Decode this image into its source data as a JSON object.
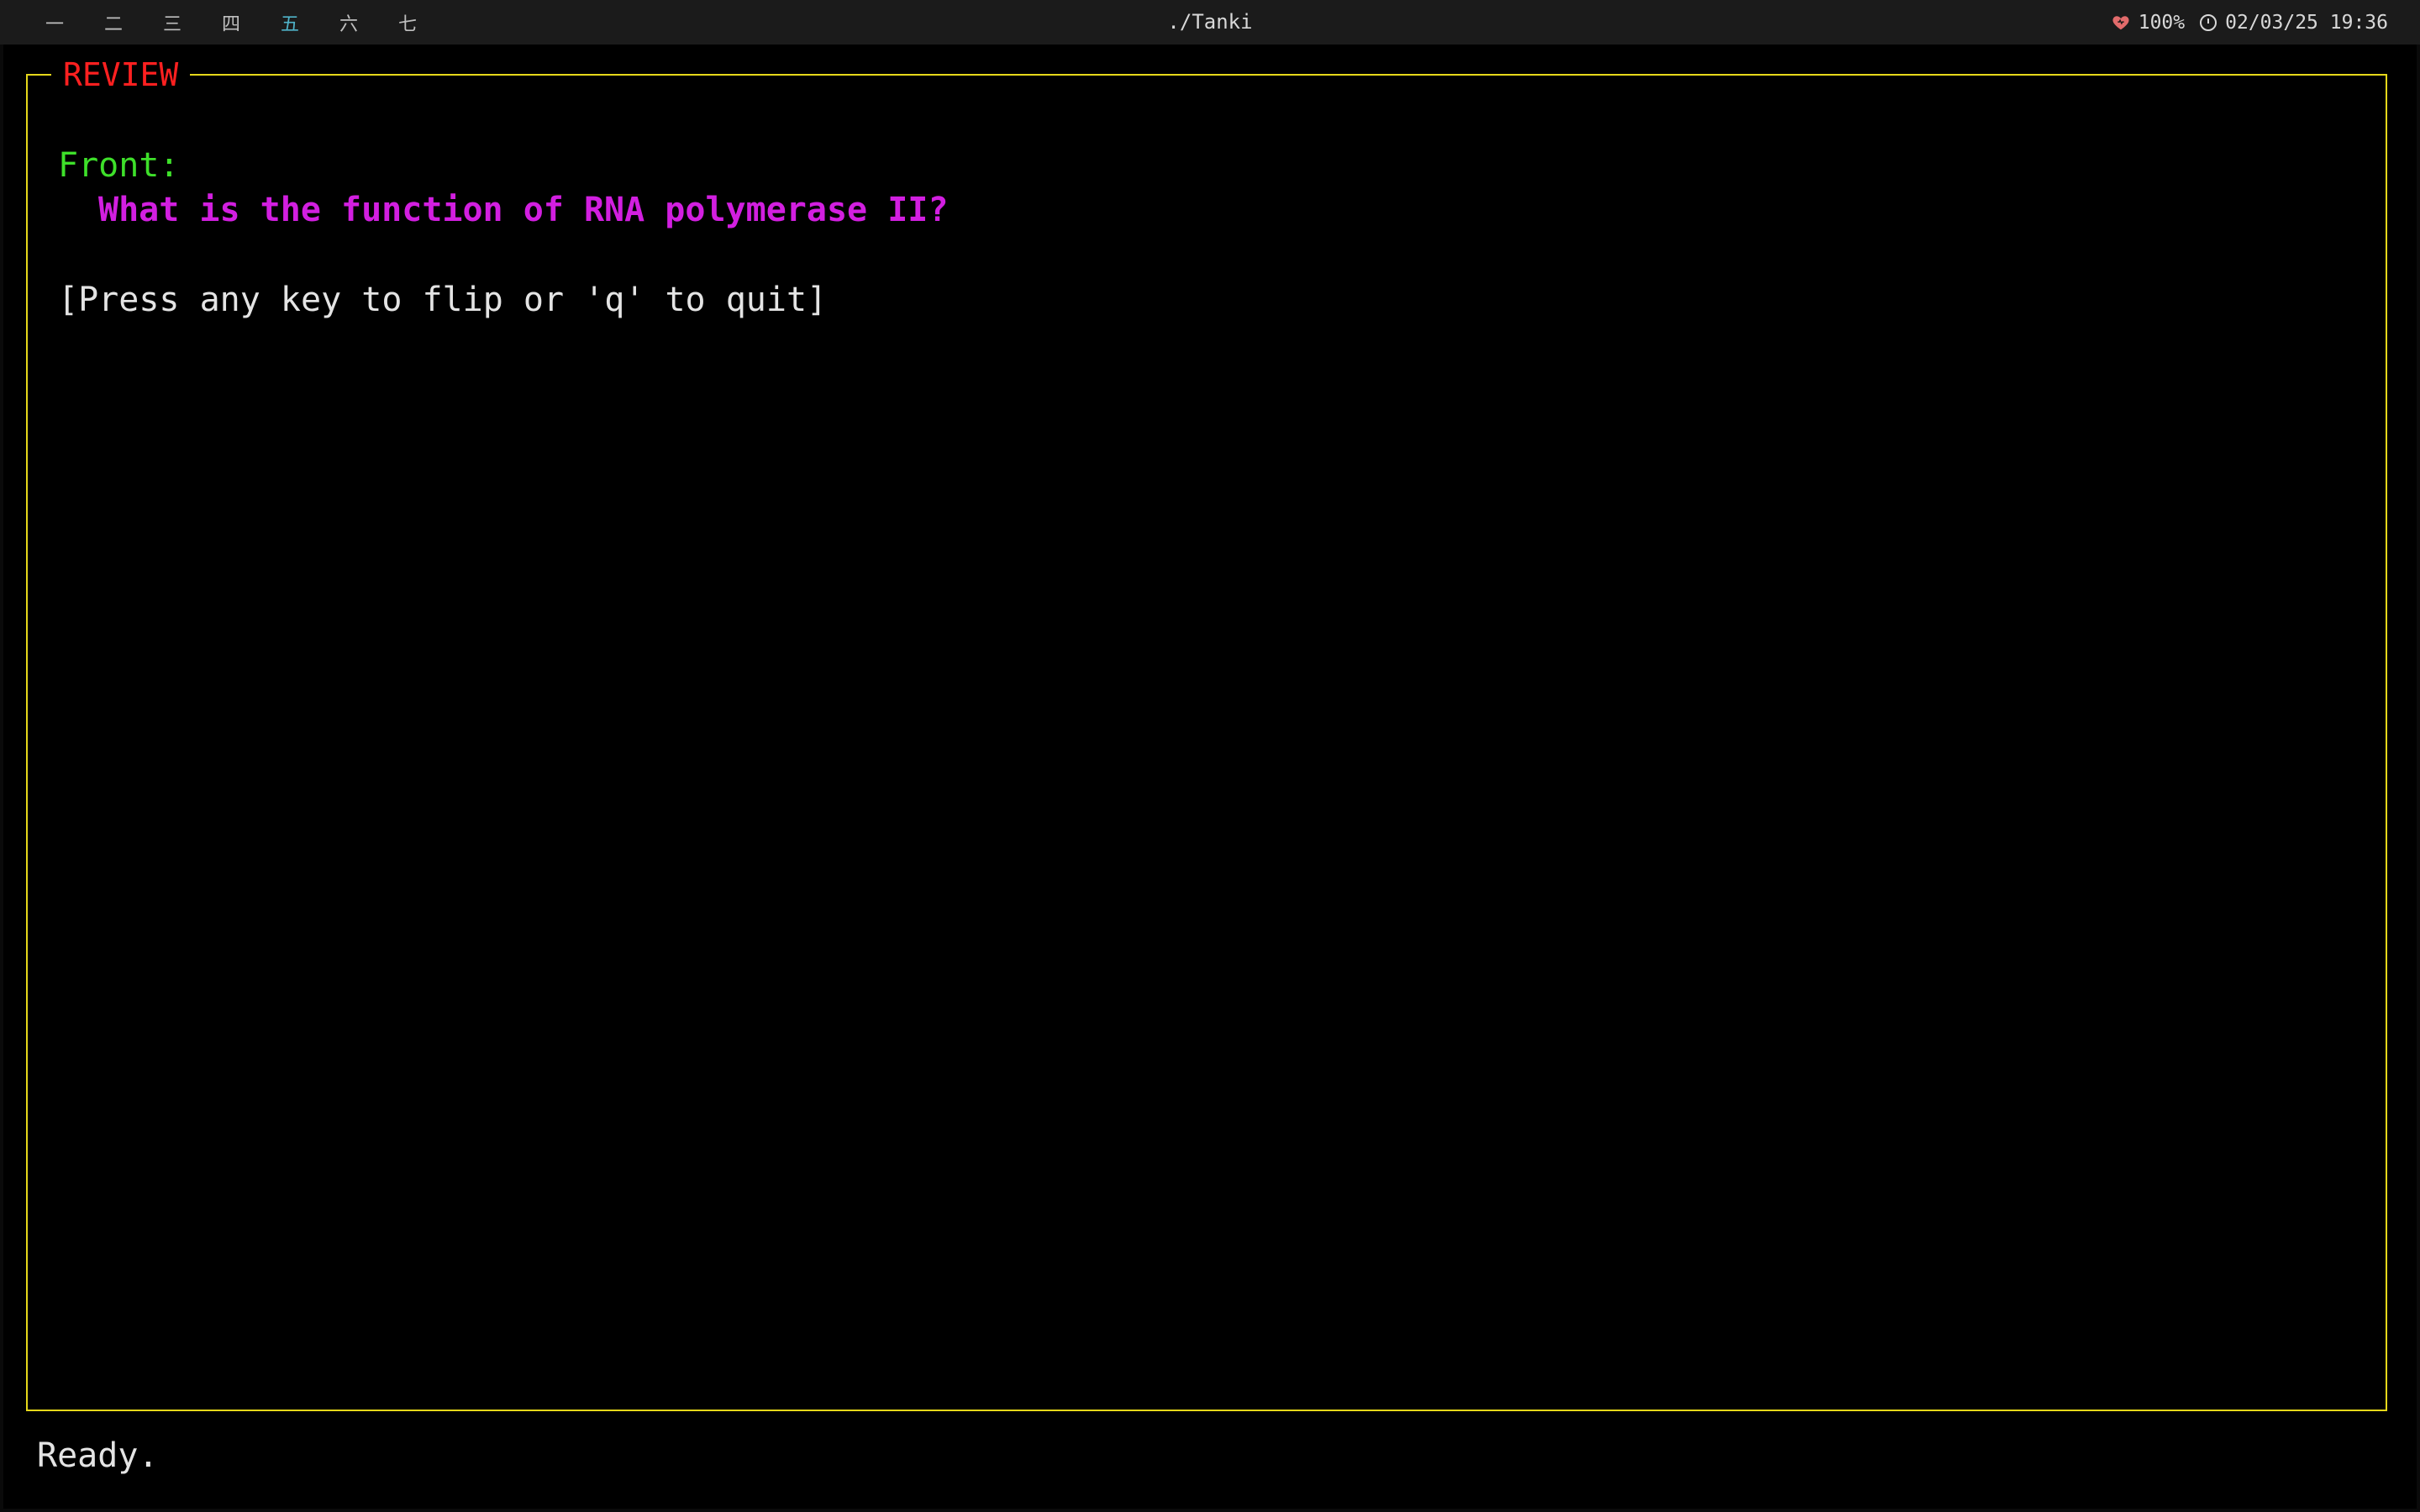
{
  "topbar": {
    "workspaces": [
      {
        "label": "一",
        "active": false
      },
      {
        "label": "二",
        "active": false
      },
      {
        "label": "三",
        "active": false
      },
      {
        "label": "四",
        "active": false
      },
      {
        "label": "五",
        "active": true
      },
      {
        "label": "六",
        "active": false
      },
      {
        "label": "七",
        "active": false
      }
    ],
    "window_title": "./Tanki",
    "battery_icon": "heart-icon",
    "battery": "100%",
    "clock_icon": "clock-icon",
    "datetime": "02/03/25 19:36"
  },
  "review": {
    "title": "REVIEW",
    "front_label": "Front:",
    "question": "What is the function of RNA polymerase II?",
    "hint": "[Press any key to flip or 'q' to quit]"
  },
  "status": {
    "message": "Ready."
  },
  "colors": {
    "border": "#e6d81a",
    "title": "#ff2020",
    "front_label": "#3ee02a",
    "question": "#d21fe0",
    "text": "#e4e4e4",
    "active_workspace": "#4fb3c9"
  }
}
